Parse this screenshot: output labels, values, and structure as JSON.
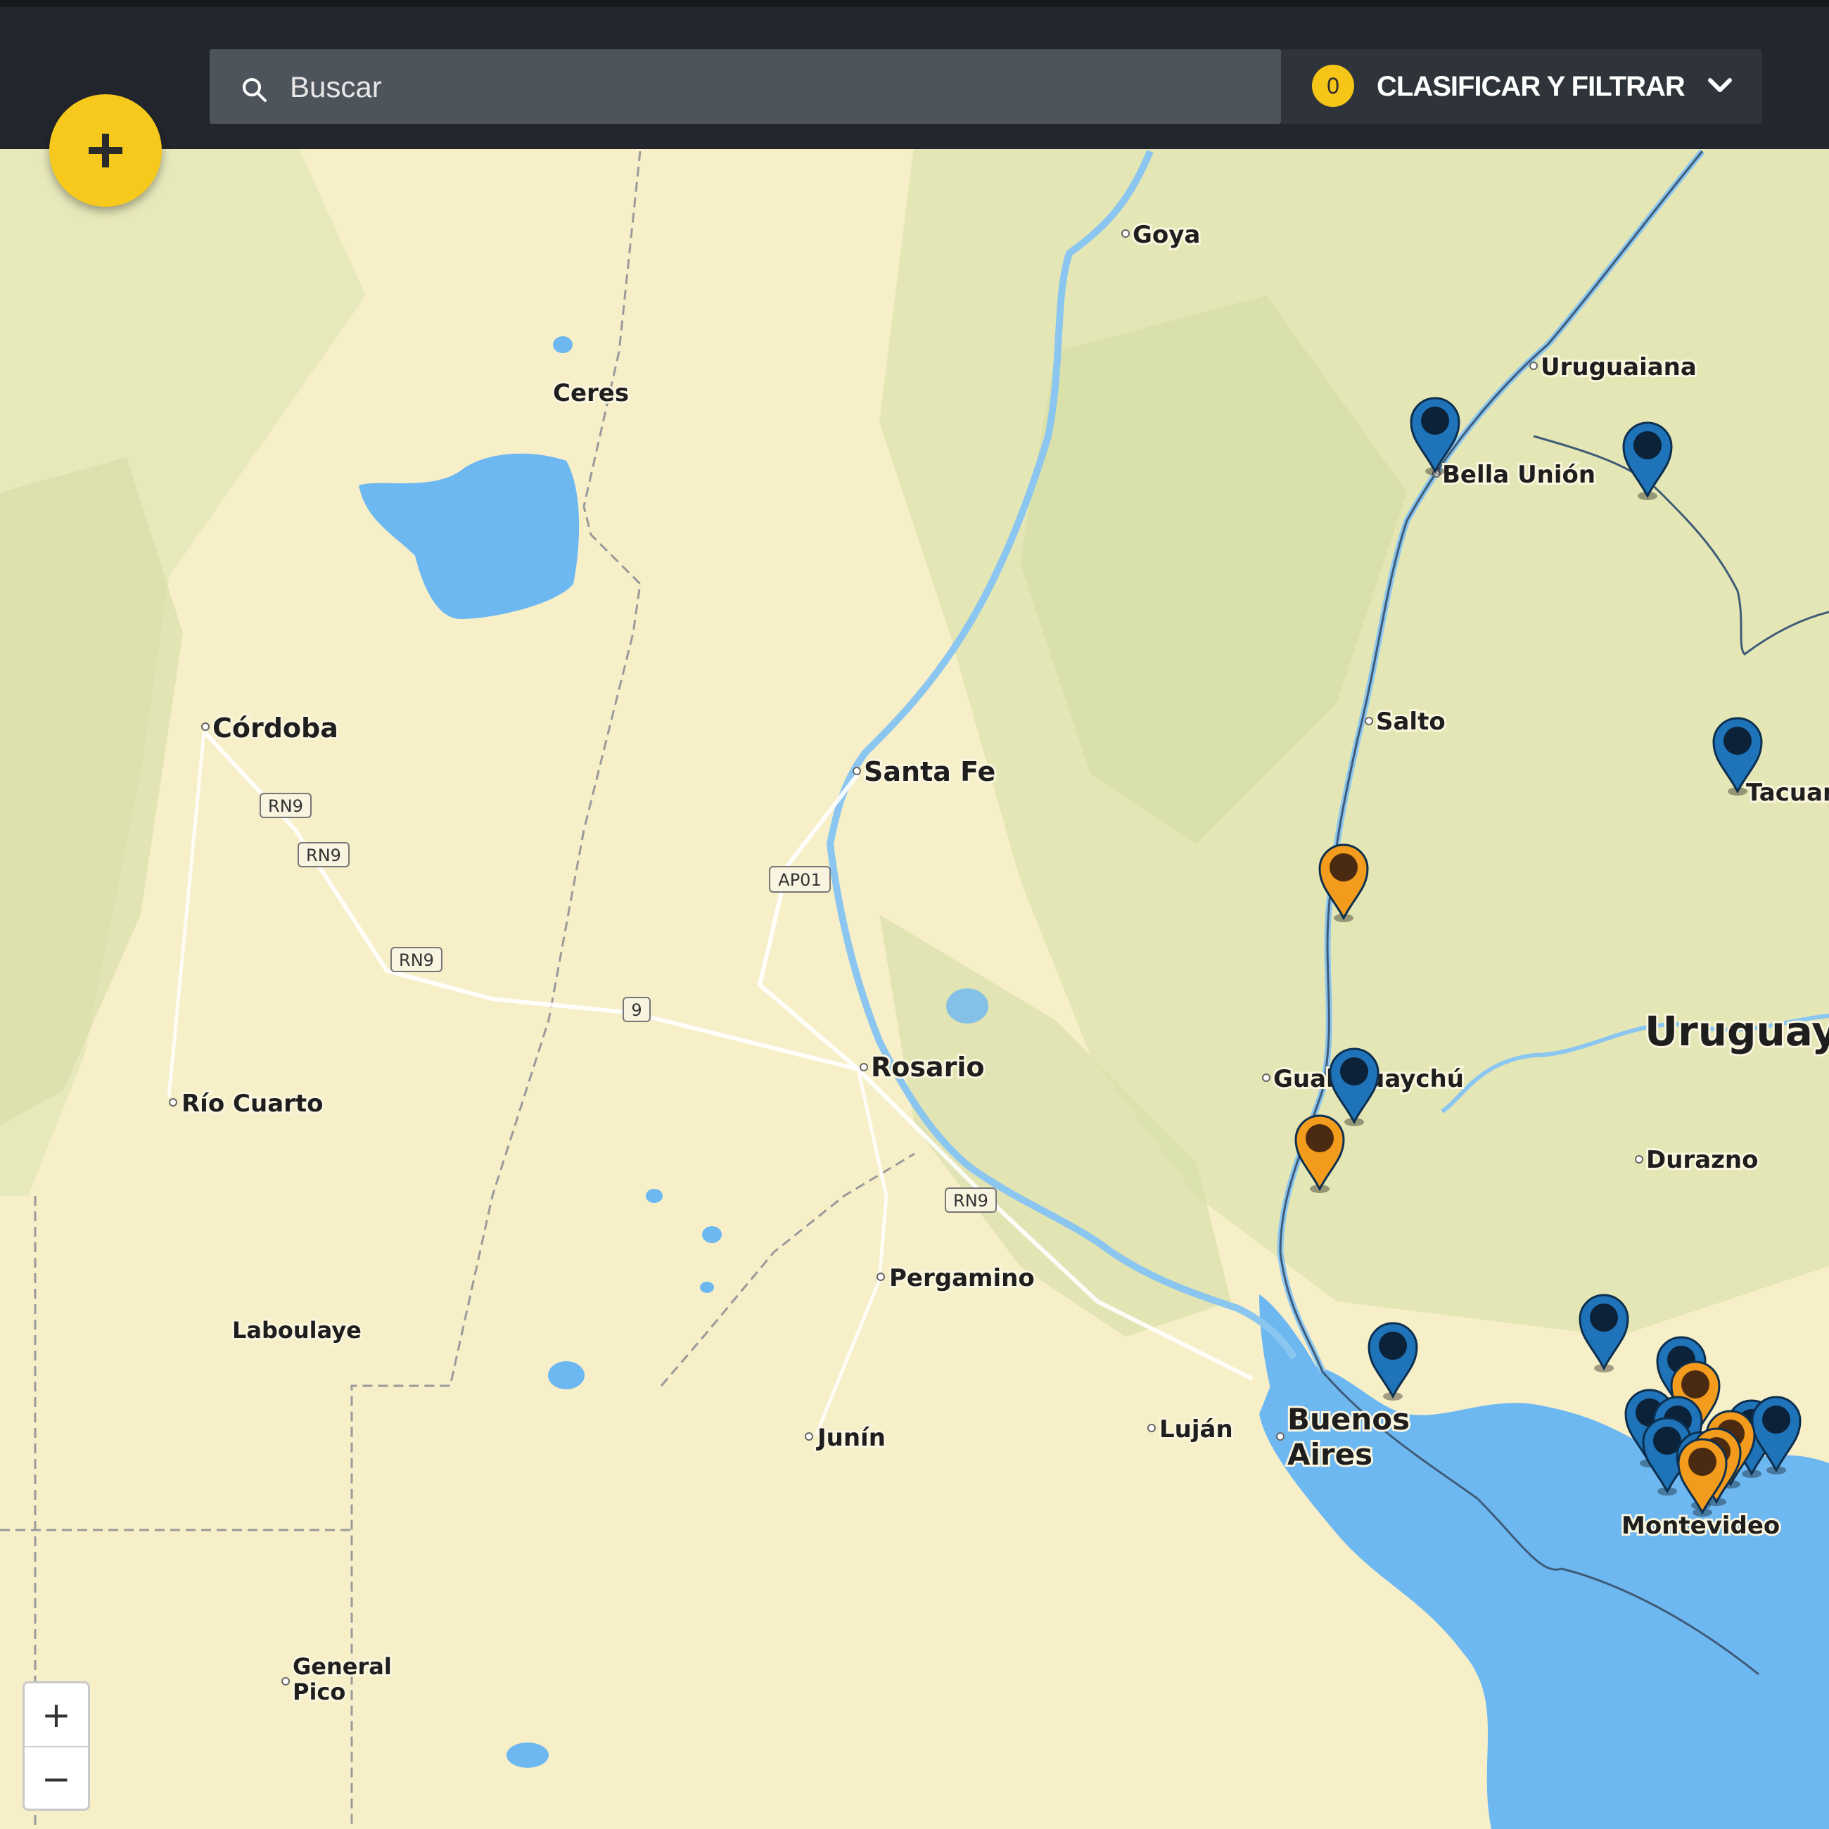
{
  "search": {
    "placeholder": "Buscar",
    "icon": "search-icon"
  },
  "filter": {
    "count": "0",
    "label": "CLASIFICAR Y FILTRAR",
    "icon": "chevron-down-icon"
  },
  "fab": {
    "icon": "plus-icon"
  },
  "zoom": {
    "in_label": "+",
    "out_label": "−"
  },
  "colors": {
    "land": "#f7efc8",
    "water": "#6eb8f2",
    "topbar": "#23272d",
    "accent": "#f5c518",
    "pin_blue": "#1f73b8",
    "pin_orange": "#f39b1c"
  },
  "places": {
    "goya": "Goya",
    "ceres": "Ceres",
    "uruguaiana": "Uruguaiana",
    "bella_union": "Bella Unión",
    "cordoba": "Córdoba",
    "santa_fe": "Santa Fe",
    "salto": "Salto",
    "tacuar": "Tacuar",
    "uruguay": "Uruguay",
    "rosario": "Rosario",
    "gualeguaychu": "Gualeguaychú",
    "rio_cuarto": "Río Cuarto",
    "durazno": "Durazno",
    "pergamino": "Pergamino",
    "laboulaye": "Laboulaye",
    "junin": "Junín",
    "lujan": "Luján",
    "buenos": "Buenos",
    "aires": "Aires",
    "montevideo": "Montevideo",
    "general": "General",
    "pico": "Pico"
  },
  "roads": {
    "rn9": "RN9",
    "ap01": "AP01",
    "partial": "9"
  }
}
